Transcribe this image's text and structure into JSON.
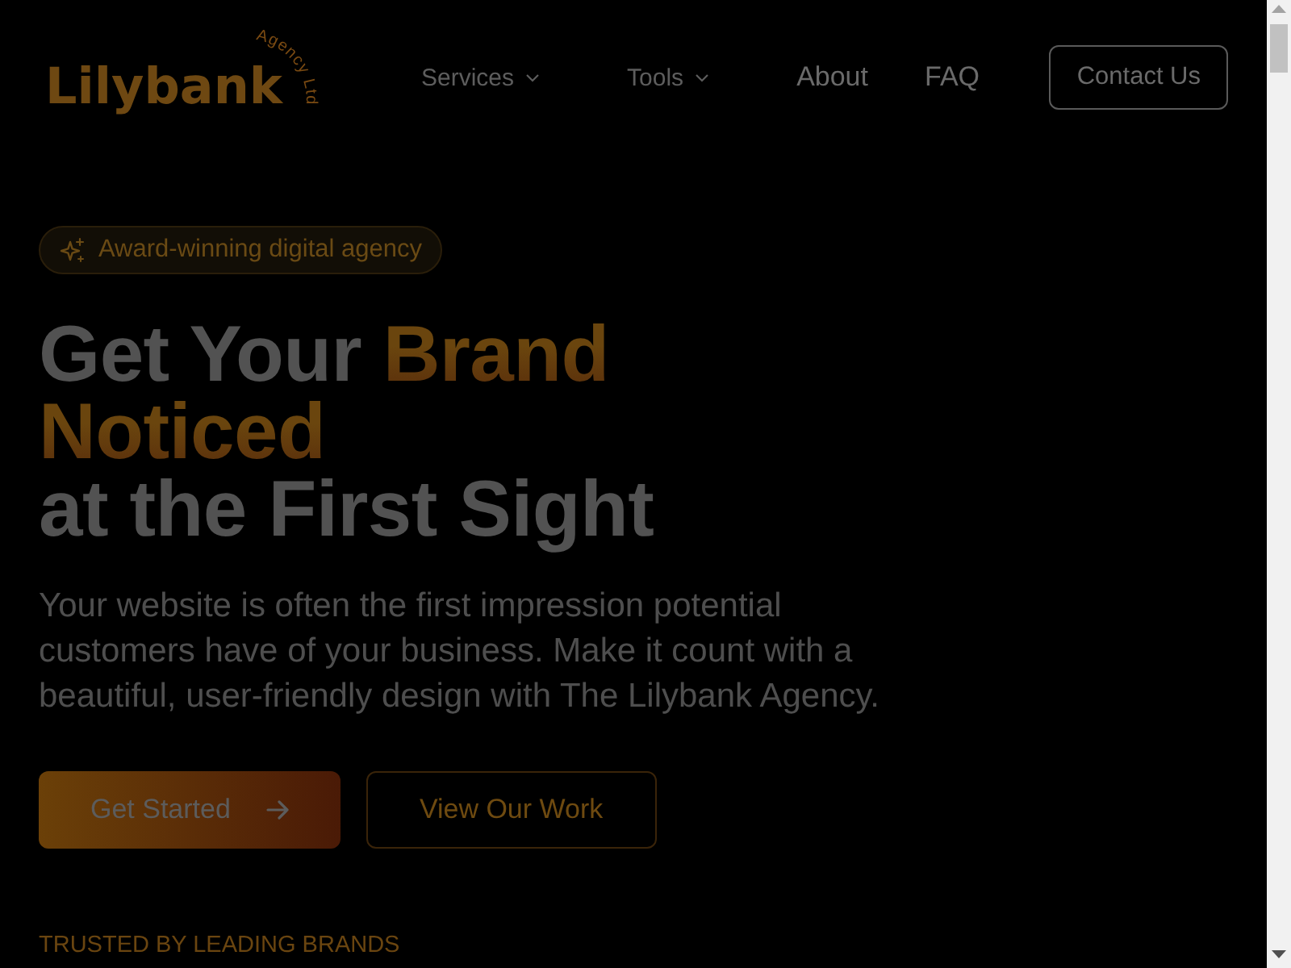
{
  "logo": {
    "name": "Lilybank",
    "tagline": "Agency Ltd"
  },
  "nav": [
    {
      "label": "Services",
      "kind": "dropdown"
    },
    {
      "label": "Tools",
      "kind": "dropdown"
    },
    {
      "label": "About",
      "kind": "link"
    },
    {
      "label": "FAQ",
      "kind": "link"
    }
  ],
  "contact_button": {
    "label": "Contact Us"
  },
  "hero": {
    "badge": "Award-winning digital agency",
    "heading": {
      "lead": "Get Your",
      "highlight": "Brand Noticed",
      "tail": "at the First Sight"
    },
    "description": "Your website is often the first impression potential customers have of your business. Make it count with a beautiful, user-friendly design with The Lilybank Agency.",
    "buttons": [
      {
        "label": "Get Started",
        "kind": "primary"
      },
      {
        "label": "View Our Work",
        "kind": "secondary"
      }
    ],
    "trusted_label": "TRUSTED BY LEADING BRANDS"
  }
}
